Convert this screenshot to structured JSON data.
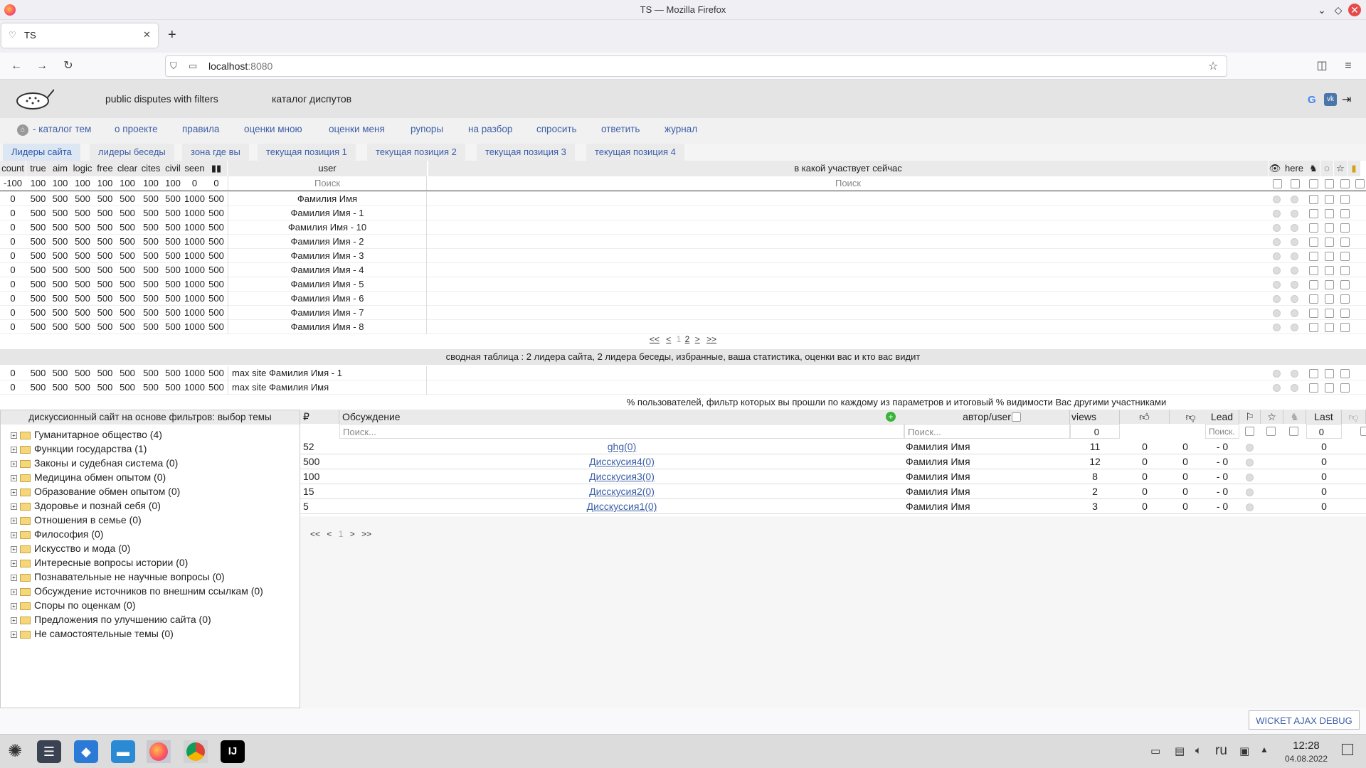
{
  "window": {
    "title": "TS — Mozilla Firefox"
  },
  "browser": {
    "tab_title": "TS",
    "new_tab": "+",
    "url_host": "localhost",
    "url_port": ":8080"
  },
  "site": {
    "header_link1": "public disputes with filters",
    "header_link2": "каталог диспутов",
    "menu": [
      "- каталог тем",
      "о проекте",
      "правила",
      "оценки мною",
      "оценки меня",
      "рупоры",
      "на разбор",
      "спросить",
      "ответить",
      "журнал"
    ],
    "tabs": [
      "Лидеры сайта",
      "лидеры беседы",
      "зона где вы",
      "текущая позиция 1",
      "текущая позиция 2",
      "текущая позиция 3",
      "текущая позиция 4"
    ]
  },
  "leaders": {
    "columns": [
      "count",
      "true",
      "aim",
      "logic",
      "free",
      "clear",
      "cites",
      "civil",
      "seen"
    ],
    "user_header": "user",
    "current_header": "в какой участвует сейчас",
    "here_label": "here",
    "filter_values": [
      "-100",
      "100",
      "100",
      "100",
      "100",
      "100",
      "100",
      "100",
      "0",
      "0"
    ],
    "search_placeholder": "Поиск",
    "rows": [
      {
        "values": [
          "0",
          "500",
          "500",
          "500",
          "500",
          "500",
          "500",
          "500",
          "1000",
          "500"
        ],
        "user": "Фамилия Имя"
      },
      {
        "values": [
          "0",
          "500",
          "500",
          "500",
          "500",
          "500",
          "500",
          "500",
          "1000",
          "500"
        ],
        "user": "Фамилия Имя - 1"
      },
      {
        "values": [
          "0",
          "500",
          "500",
          "500",
          "500",
          "500",
          "500",
          "500",
          "1000",
          "500"
        ],
        "user": "Фамилия Имя - 10"
      },
      {
        "values": [
          "0",
          "500",
          "500",
          "500",
          "500",
          "500",
          "500",
          "500",
          "1000",
          "500"
        ],
        "user": "Фамилия Имя - 2"
      },
      {
        "values": [
          "0",
          "500",
          "500",
          "500",
          "500",
          "500",
          "500",
          "500",
          "1000",
          "500"
        ],
        "user": "Фамилия Имя - 3"
      },
      {
        "values": [
          "0",
          "500",
          "500",
          "500",
          "500",
          "500",
          "500",
          "500",
          "1000",
          "500"
        ],
        "user": "Фамилия Имя - 4"
      },
      {
        "values": [
          "0",
          "500",
          "500",
          "500",
          "500",
          "500",
          "500",
          "500",
          "1000",
          "500"
        ],
        "user": "Фамилия Имя - 5"
      },
      {
        "values": [
          "0",
          "500",
          "500",
          "500",
          "500",
          "500",
          "500",
          "500",
          "1000",
          "500"
        ],
        "user": "Фамилия Имя - 6"
      },
      {
        "values": [
          "0",
          "500",
          "500",
          "500",
          "500",
          "500",
          "500",
          "500",
          "1000",
          "500"
        ],
        "user": "Фамилия Имя - 7"
      },
      {
        "values": [
          "0",
          "500",
          "500",
          "500",
          "500",
          "500",
          "500",
          "500",
          "1000",
          "500"
        ],
        "user": "Фамилия Имя - 8"
      }
    ],
    "pager": [
      "<<",
      "<",
      "1",
      "2",
      ">",
      ">>"
    ],
    "summary_title": "сводная таблица : 2 лидера сайта, 2 лидера беседы, избранные, ваша статистика, оценки вас и кто вас видит",
    "summary_rows": [
      {
        "values": [
          "0",
          "500",
          "500",
          "500",
          "500",
          "500",
          "500",
          "500",
          "1000",
          "500"
        ],
        "user": "max site Фамилия Имя - 1"
      },
      {
        "values": [
          "0",
          "500",
          "500",
          "500",
          "500",
          "500",
          "500",
          "500",
          "1000",
          "500"
        ],
        "user": "max site Фамилия Имя"
      }
    ],
    "footnote": "% пользователей, фильтр которых вы прошли по каждому из параметров и итоговый % видимости Вас другими участниками"
  },
  "tree": {
    "title": "дискуссионный сайт на основе фильтров: выбор темы",
    "items": [
      "Гуманитарное общество (4)",
      "Функции государства (1)",
      "Законы и судебная система (0)",
      "Медицина обмен опытом (0)",
      "Образование обмен опытом (0)",
      "Здоровье и познай себя (0)",
      "Отношения в семье (0)",
      "Философия (0)",
      "Искусство и мода (0)",
      "Интересные вопросы истории (0)",
      "Познавательные не научные вопросы (0)",
      "Обсуждение источников по внешним ссылкам (0)",
      "Споры по оценкам (0)",
      "Предложения по улучшению сайта (0)",
      "Не самостоятельные темы (0)"
    ]
  },
  "discussions": {
    "col_rub": "₽",
    "col_title": "Обсуждение",
    "col_author": "автор/user",
    "col_views": "views",
    "col_lead": "Lead",
    "col_last": "Last",
    "search_placeholder": "Поиск...",
    "search_placeholder_short": "Поиск.",
    "views_filter": "0",
    "last_filter": "0",
    "rows": [
      {
        "rub": "52",
        "title": "ghg(0)",
        "author": "Фамилия Имя",
        "views": "11",
        "up": "0",
        "down": "0",
        "lead": "- 0",
        "last": "0"
      },
      {
        "rub": "500",
        "title": "Дисскусия4(0)",
        "author": "Фамилия Имя",
        "views": "12",
        "up": "0",
        "down": "0",
        "lead": "- 0",
        "last": "0"
      },
      {
        "rub": "100",
        "title": "Дисскусия3(0)",
        "author": "Фамилия Имя",
        "views": "8",
        "up": "0",
        "down": "0",
        "lead": "- 0",
        "last": "0"
      },
      {
        "rub": "15",
        "title": "Дисскусия2(0)",
        "author": "Фамилия Имя",
        "views": "2",
        "up": "0",
        "down": "0",
        "lead": "- 0",
        "last": "0"
      },
      {
        "rub": "5",
        "title": "Дисскуссия1(0)",
        "author": "Фамилия Имя",
        "views": "3",
        "up": "0",
        "down": "0",
        "lead": "- 0",
        "last": "0"
      }
    ],
    "pager": [
      "<<",
      "<",
      "1",
      ">",
      ">>"
    ]
  },
  "debug_button": "WICKET AJAX DEBUG",
  "taskbar": {
    "lang": "ru",
    "time": "12:28",
    "date": "04.08.2022"
  }
}
